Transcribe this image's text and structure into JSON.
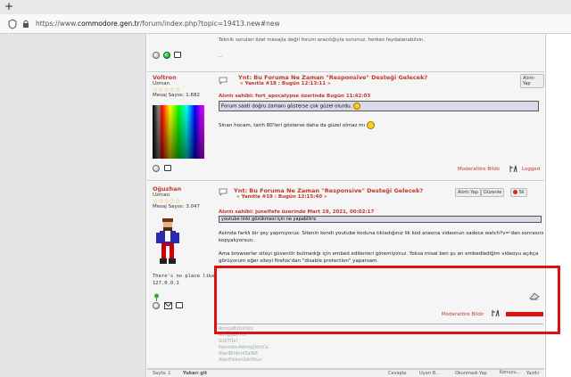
{
  "browser": {
    "url_prefix": "https://www.",
    "url_host": "commodore.gen.tr",
    "url_path": "/forum/index.php?topic=19413.new#new"
  },
  "top_note": "Teknik soruları özel mesajla değil forum aracılığıyla sorunuz, herkes faydalanabilsin.",
  "top_ellipsis": "...",
  "post1": {
    "username": "Voltron",
    "rank": "Uzman",
    "stars": "☆☆☆☆☆",
    "message_count": "Mesaj Sayısı: 1.682",
    "title": "Ynt: Bu Foruma Ne Zaman \"Responsive\" Desteği Gelecek?",
    "subtitle": "« Yanıtla #18 : Bugün 12:13:11 »",
    "quote_button": "Alıntı Yap",
    "quote_header": "Alıntı sahibi: fort_apocalypse üzerinde Bugün  11:42:03",
    "quote_text": "Forum saati doğru zamanı gösterse çok güzel olurdu.",
    "body": "Sinan hocam, tarih 80'leri gösterse daha da güzel olmaz mı",
    "report": "Moderatöre Bildir",
    "logged": "Logged"
  },
  "post2": {
    "username": "Oğuzhan",
    "rank": "Uzman",
    "stars": "☆☆☆☆☆",
    "message_count": "Mesaj Sayısı: 3.047",
    "title": "Ynt: Bu Foruma Ne Zaman \"Responsive\" Desteği Gelecek?",
    "subtitle": "« Yanıtla #19 : Bugün 12:15:40 »",
    "quote_button": "Alıntı Yap",
    "edit_button": "Düzenle",
    "delete_button": "Sil",
    "quote_header": "Alıntı sahibi: junelfefe üzerinde Mart 19, 2021, 00:02:17",
    "quote_text": "youtube linki gözükmesi için ne yapabiliriz",
    "body1": "Aslında farklı bir şey yapmıyoruz. Sitenin kendi youtube koduna tıkladığınız ilk kod arasına videonun sadece watch?v='dan sonrasını kopyalıyorsun.",
    "body2": "Ama browserlar siteyi güvenilir bulmadığı için embed edilenleri göremiyoruz. Yoksa misal ben şu an embedlediğim videoyu açıkça görüyorum eğer siteyi firefox'dan \"disable protection\" yaparsam.",
    "signature_text1": "There's no place like",
    "signature_text2": "127.0.0.1",
    "report": "Moderatöre Bildir",
    "signature_lines": [
      "AmigaBirDüYolc",
      "AmigaBirYÜr",
      "SiDiTÜvi",
      "KomodorAlbmgDörtCa",
      "AtariBinKirkSaTeE",
      "AtariFalkonSArOtuz"
    ]
  },
  "bottom": {
    "page_label": "Sayfa: 1",
    "page_link": "Yukarı git",
    "actions": [
      "Cevapla",
      "Uyarı B...",
      "Okunmadı Yap",
      "Konuyu...",
      "Yazdır"
    ]
  },
  "colors": {
    "accent_red": "#c0392b",
    "highlight_red": "#e01010",
    "star_gold": "#e3a000",
    "quote_bg": "#d8dae8"
  }
}
